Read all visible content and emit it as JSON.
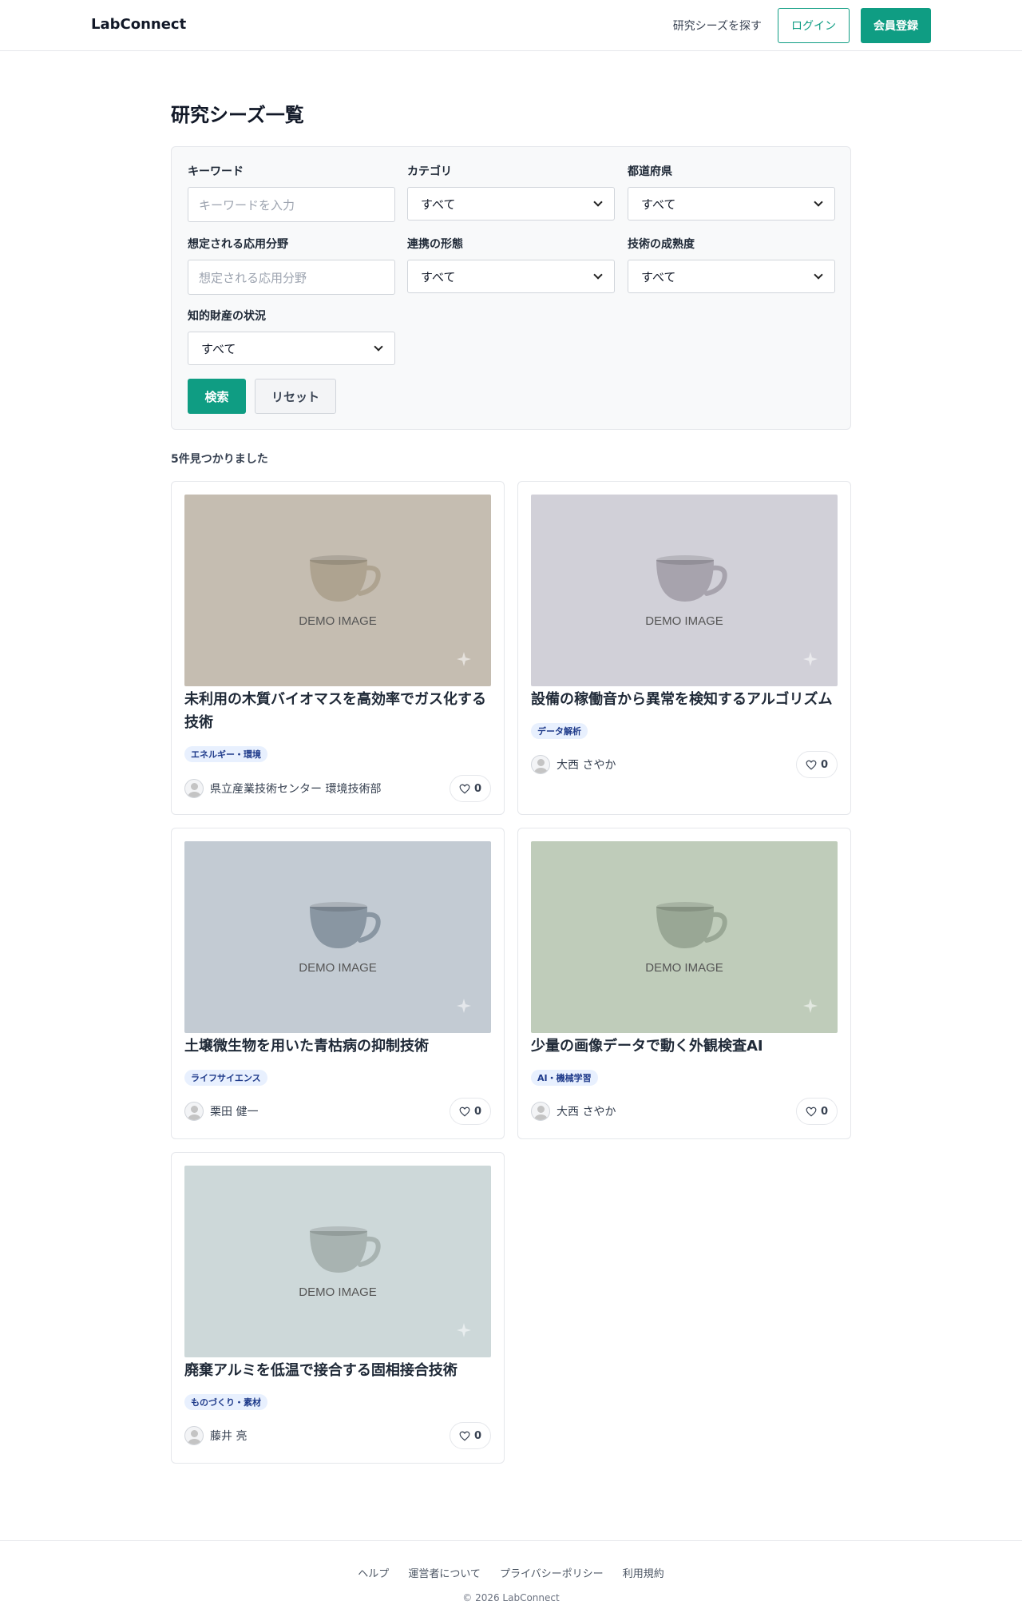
{
  "header": {
    "logo": "LabConnect",
    "nav_link": "研究シーズを探す",
    "login_label": "ログイン",
    "register_label": "会員登録"
  },
  "page_title": "研究シーズ一覧",
  "filters": {
    "keyword": {
      "label": "キーワード",
      "placeholder": "キーワードを入力"
    },
    "category": {
      "label": "カテゴリ",
      "value": "すべて"
    },
    "prefecture": {
      "label": "都道府県",
      "value": "すべて"
    },
    "application": {
      "label": "想定される応用分野",
      "placeholder": "想定される応用分野"
    },
    "collaboration": {
      "label": "連携の形態",
      "value": "すべて"
    },
    "maturity": {
      "label": "技術の成熟度",
      "value": "すべて"
    },
    "ip_status": {
      "label": "知的財産の状況",
      "value": "すべて"
    },
    "search_label": "検索",
    "reset_label": "リセット"
  },
  "result_count": "5件見つかりました",
  "image_label": "DEMO IMAGE",
  "cards": [
    {
      "title": "未利用の木質バイオマスを高効率でガス化する技術",
      "tag": "エネルギー・環境",
      "author": "県立産業技術センター 環境技術部",
      "likes": "0",
      "img_bg": "#c5bdb1",
      "cup": "#aea390"
    },
    {
      "title": "設備の稼働音から異常を検知するアルゴリズム",
      "tag": "データ解析",
      "author": "大西 さやか",
      "likes": "0",
      "img_bg": "#d1d0d8",
      "cup": "#a7a3ad"
    },
    {
      "title": "土壌微生物を用いた青枯病の抑制技術",
      "tag": "ライフサイエンス",
      "author": "栗田 健一",
      "likes": "0",
      "img_bg": "#c3cbd3",
      "cup": "#8996a2"
    },
    {
      "title": "少量の画像データで動く外観検査AI",
      "tag": "AI・機械学習",
      "author": "大西 さやか",
      "likes": "0",
      "img_bg": "#bfccba",
      "cup": "#99a795"
    },
    {
      "title": "廃棄アルミを低温で接合する固相接合技術",
      "tag": "ものづくり・素材",
      "author": "藤井 亮",
      "likes": "0",
      "img_bg": "#cdd8d9",
      "cup": "#a8b3b1"
    }
  ],
  "footer": {
    "links": [
      "ヘルプ",
      "運営者について",
      "プライバシーポリシー",
      "利用規約"
    ],
    "copyright": "© 2026 LabConnect"
  }
}
